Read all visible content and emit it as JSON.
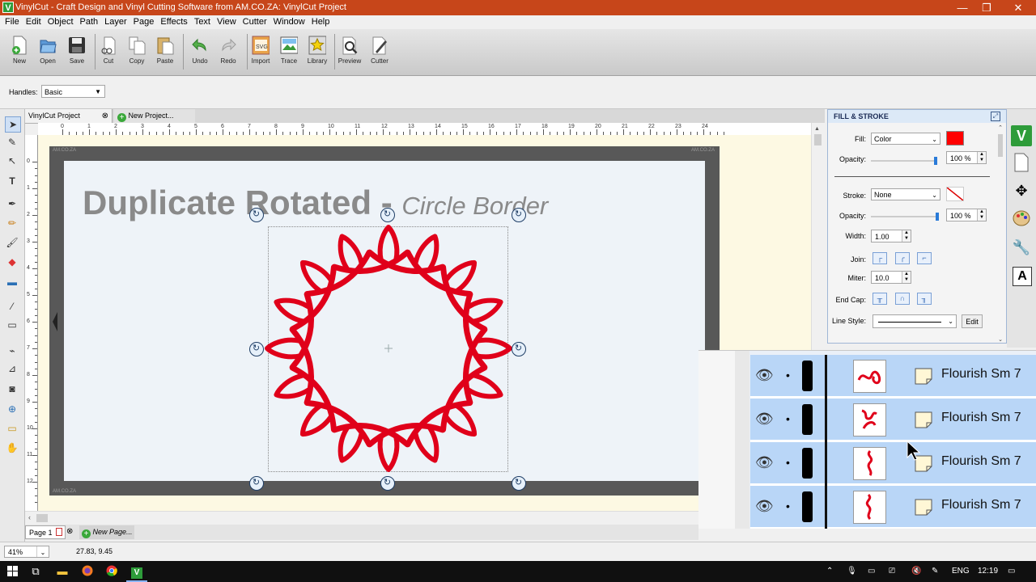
{
  "window": {
    "title": "VinylCut - Craft Design and Vinyl Cutting Software from AM.CO.ZA: VinylCut Project",
    "app_icon": "V",
    "controls": [
      "—",
      "❐",
      "✕"
    ]
  },
  "menu": [
    "File",
    "Edit",
    "Object",
    "Path",
    "Layer",
    "Page",
    "Effects",
    "Text",
    "View",
    "Cutter",
    "Window",
    "Help"
  ],
  "toolbar": {
    "buttons": [
      {
        "label": "New",
        "icon": "new-file-icon"
      },
      {
        "label": "Open",
        "icon": "open-folder-icon"
      },
      {
        "label": "Save",
        "icon": "save-disk-icon"
      },
      {
        "label": "Cut",
        "icon": "scissors-icon"
      },
      {
        "label": "Copy",
        "icon": "copy-icon"
      },
      {
        "label": "Paste",
        "icon": "paste-icon"
      },
      {
        "label": "Undo",
        "icon": "undo-icon"
      },
      {
        "label": "Redo",
        "icon": "redo-icon"
      },
      {
        "label": "Import",
        "icon": "import-svg-icon"
      },
      {
        "label": "Trace",
        "icon": "trace-icon"
      },
      {
        "label": "Library",
        "icon": "library-star-icon"
      },
      {
        "label": "Preview",
        "icon": "preview-magnifier-icon"
      },
      {
        "label": "Cutter",
        "icon": "cutter-blade-icon"
      }
    ]
  },
  "handles": {
    "label": "Handles:",
    "value": "Basic"
  },
  "doc_tabs": [
    {
      "label": "VinylCut Project",
      "active": true
    },
    {
      "label": "New Project...",
      "active": false
    }
  ],
  "ruler": {
    "h": [
      "0",
      "1",
      "2",
      "3",
      "4",
      "5",
      "6",
      "7",
      "8",
      "9",
      "10",
      "11",
      "12",
      "13",
      "14",
      "15",
      "16",
      "17",
      "18",
      "19",
      "20",
      "21",
      "22",
      "23",
      "24"
    ],
    "v": [
      "0",
      "1",
      "2",
      "3",
      "4",
      "5",
      "6",
      "7",
      "8",
      "9",
      "10",
      "11",
      "12"
    ]
  },
  "canvas": {
    "heading": "Duplicate Rotated -",
    "subheading": "Circle Border",
    "mat_label": "AM.CO.ZA",
    "shape_color": "#e0001a"
  },
  "page_tabs": [
    {
      "label": "Page 1"
    },
    {
      "label": "New Page..."
    }
  ],
  "fill_stroke": {
    "title": "FILL & STROKE",
    "fill_label": "Fill:",
    "fill_type": "Color",
    "fill_color": "#ff0000",
    "opacity_label": "Opacity:",
    "fill_opacity": "100 %",
    "stroke_label": "Stroke:",
    "stroke_type": "None",
    "stroke_opacity": "100 %",
    "width_label": "Width:",
    "width_value": "1.00",
    "join_label": "Join:",
    "miter_label": "Miter:",
    "miter_value": "10.0",
    "endcap_label": "End Cap:",
    "linestyle_label": "Line Style:",
    "edit_label": "Edit"
  },
  "side_icons": [
    "vinylcut-logo-icon",
    "page-icon",
    "move-arrows-icon",
    "palette-icon",
    "wrench-icon",
    "text-aa-icon"
  ],
  "layers": [
    {
      "name": "Flourish Sm 7"
    },
    {
      "name": "Flourish Sm 7"
    },
    {
      "name": "Flourish Sm 7"
    },
    {
      "name": "Flourish Sm 7"
    }
  ],
  "status": {
    "zoom": "41%",
    "coords": "27.83, 9.45"
  },
  "taskbar": {
    "tray_lang": "ENG",
    "time": "12:19"
  }
}
